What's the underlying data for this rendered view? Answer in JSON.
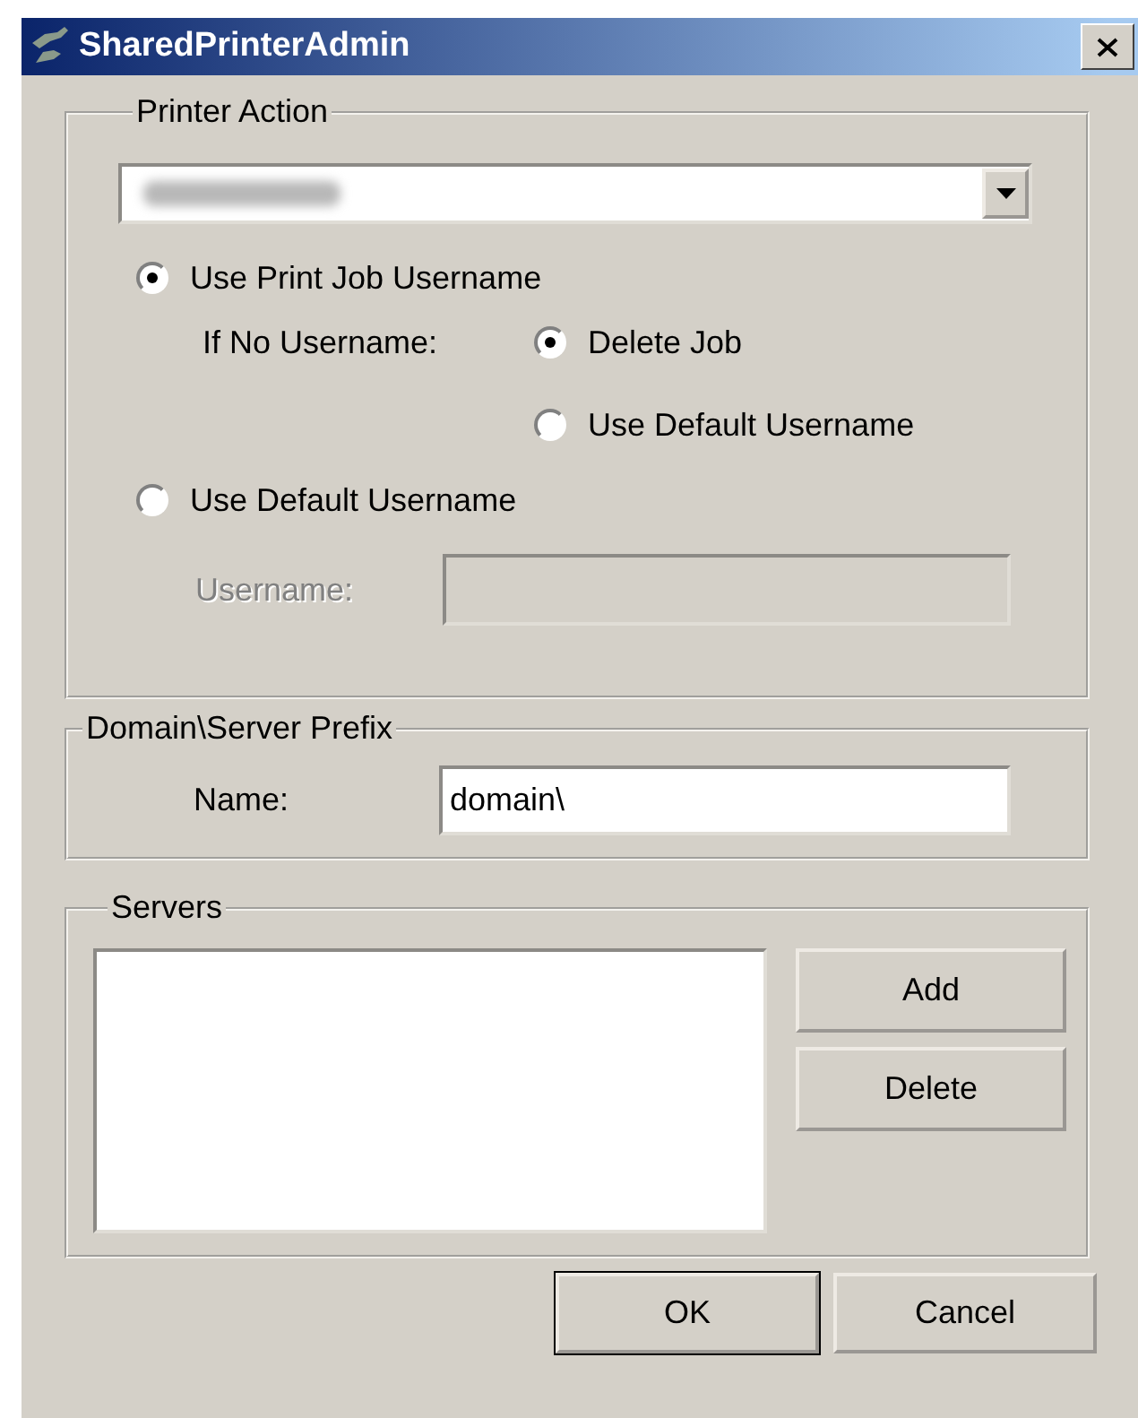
{
  "window": {
    "title": "SharedPrinterAdmin"
  },
  "printer_action": {
    "legend": "Printer Action",
    "mode_options": [
      {
        "label": "Use Print Job Username",
        "selected": true
      },
      {
        "label": "Use Default Username",
        "selected": false
      }
    ],
    "if_no_username": {
      "label": "If No Username:",
      "options": [
        {
          "label": "Delete Job",
          "selected": true
        },
        {
          "label": "Use Default Username",
          "selected": false
        }
      ]
    },
    "username": {
      "label": "Username:",
      "disabled": true
    }
  },
  "domain_prefix": {
    "legend": "Domain\\Server Prefix",
    "name_label": "Name:",
    "name_value": "domain\\"
  },
  "servers": {
    "legend": "Servers",
    "buttons": [
      "Add",
      "Delete"
    ]
  },
  "buttons": [
    {
      "label": "OK",
      "default": true
    },
    {
      "label": "Cancel",
      "default": false
    }
  ]
}
